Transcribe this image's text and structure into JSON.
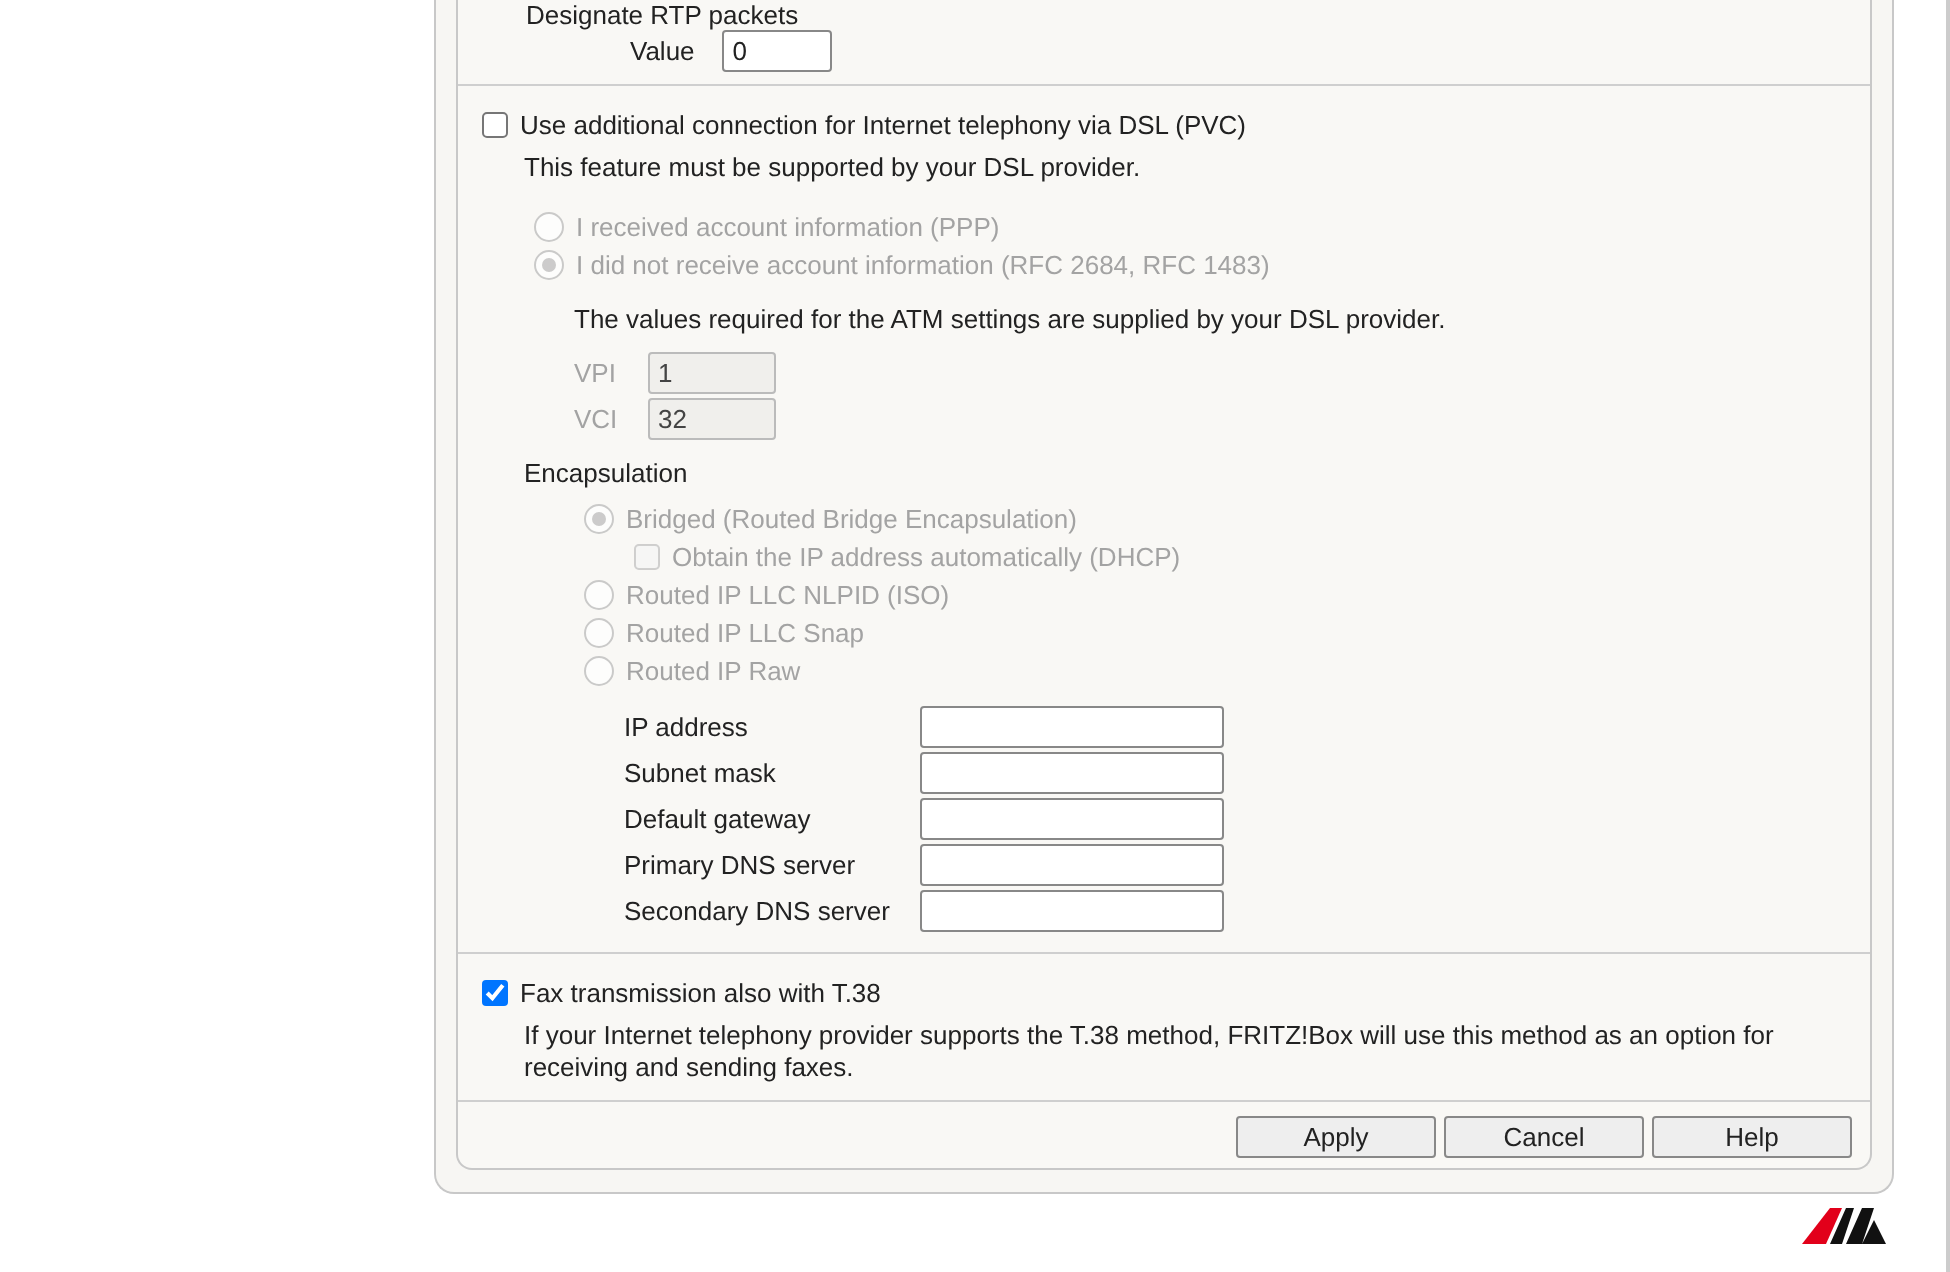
{
  "rtp": {
    "heading": "Designate RTP packets",
    "value_label": "Value",
    "value": "0"
  },
  "pvc": {
    "checked": false,
    "label": "Use additional connection for Internet telephony via DSL (PVC)",
    "note": "This feature must be supported by your DSL provider.",
    "account_options": [
      {
        "label": "I received account information (PPP)",
        "selected": false,
        "disabled": true
      },
      {
        "label": "I did not receive account information (RFC 2684, RFC 1483)",
        "selected": true,
        "disabled": true
      }
    ],
    "atm_note": "The values required for the ATM settings are supplied by your DSL provider.",
    "atm_fields": [
      {
        "label": "VPI",
        "value": "1",
        "disabled": true
      },
      {
        "label": "VCI",
        "value": "32",
        "disabled": true
      }
    ],
    "encapsulation_title": "Encapsulation",
    "encapsulation_options": [
      {
        "label": "Bridged (Routed Bridge Encapsulation)",
        "selected": true,
        "disabled": true,
        "children": [
          {
            "label": "Obtain the IP address automatically (DHCP)",
            "checked": false,
            "disabled": true
          }
        ]
      },
      {
        "label": "Routed IP LLC NLPID (ISO)",
        "selected": false,
        "disabled": true
      },
      {
        "label": "Routed IP LLC Snap",
        "selected": false,
        "disabled": true
      },
      {
        "label": "Routed IP Raw",
        "selected": false,
        "disabled": true
      }
    ],
    "ip_fields": [
      {
        "label": "IP address"
      },
      {
        "label": "Subnet mask"
      },
      {
        "label": "Default gateway"
      },
      {
        "label": "Primary DNS server"
      },
      {
        "label": "Secondary DNS server"
      }
    ]
  },
  "fax": {
    "checked": true,
    "label": "Fax transmission also with T.38",
    "note": "If your Internet telephony provider supports the T.38 method, FRITZ!Box will use this method as an option for receiving and sending faxes."
  },
  "buttons": [
    "Apply",
    "Cancel",
    "Help"
  ]
}
